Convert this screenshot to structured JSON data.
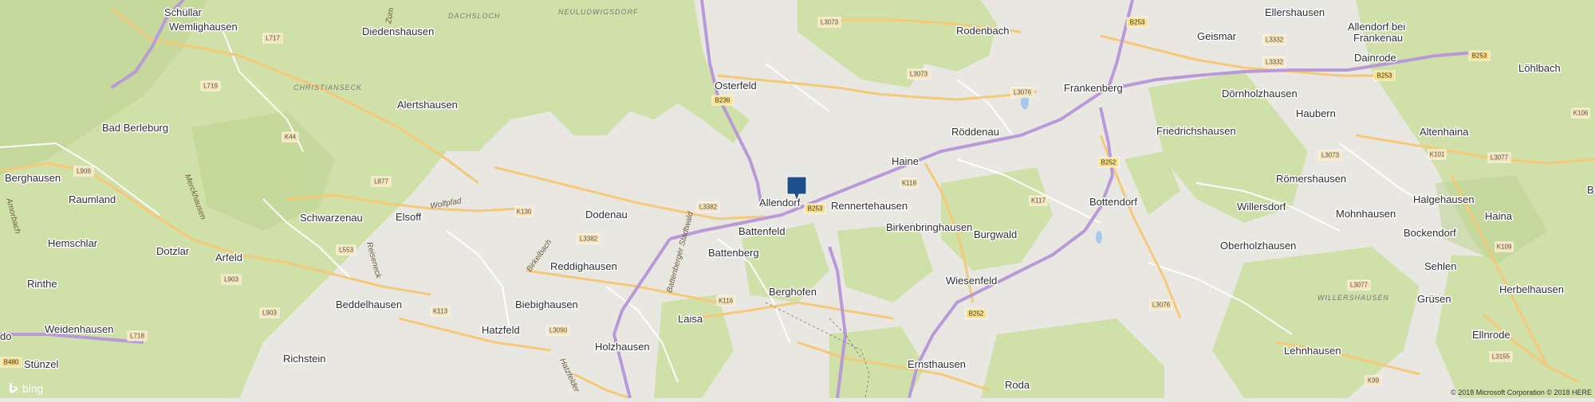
{
  "map": {
    "provider": "bing",
    "copyright": "© 2018 Microsoft Corporation © 2018 HERE",
    "colors": {
      "land": "#e9e7e2",
      "forest": "#cfe0a8",
      "forest_dark": "#bcd48f",
      "highway": "#b89ad8",
      "main_road": "#f5c97a",
      "minor_road": "#ffffff",
      "marker": "#1f4e8c",
      "water": "#a9c8ec"
    },
    "marker": {
      "icon": "map-pin-marker"
    },
    "places": [
      {
        "key": "schullar",
        "name": "Schüllar"
      },
      {
        "key": "wemlighausen",
        "name": "Wemlighausen"
      },
      {
        "key": "diedenshausen",
        "name": "Diedenshausen"
      },
      {
        "key": "alertshausen",
        "name": "Alertshausen"
      },
      {
        "key": "bad_berleburg",
        "name": "Bad Berleburg"
      },
      {
        "key": "berghausen",
        "name": "Berghausen"
      },
      {
        "key": "raumland",
        "name": "Raumland"
      },
      {
        "key": "schwarzenau",
        "name": "Schwarzenau"
      },
      {
        "key": "elsoff",
        "name": "Elsoff"
      },
      {
        "key": "hemschlar",
        "name": "Hemschlar"
      },
      {
        "key": "dotzlar",
        "name": "Dotzlar"
      },
      {
        "key": "arfeld",
        "name": "Arfeld"
      },
      {
        "key": "rinthe",
        "name": "Rinthe"
      },
      {
        "key": "beddelhausen",
        "name": "Beddelhausen"
      },
      {
        "key": "weidenhausen",
        "name": "Weidenhausen"
      },
      {
        "key": "stunzel",
        "name": "Stünzel"
      },
      {
        "key": "richstein",
        "name": "Richstein"
      },
      {
        "key": "hatzfeld",
        "name": "Hatzfeld"
      },
      {
        "key": "dodenau",
        "name": "Dodenau"
      },
      {
        "key": "reddighausen",
        "name": "Reddighausen"
      },
      {
        "key": "biebighausen",
        "name": "Biebighausen"
      },
      {
        "key": "holzhausen",
        "name": "Holzhausen"
      },
      {
        "key": "osterfeld",
        "name": "Osterfeld"
      },
      {
        "key": "allendorf",
        "name": "Allendorf"
      },
      {
        "key": "battenfeld",
        "name": "Battenfeld"
      },
      {
        "key": "battenberg",
        "name": "Battenberg"
      },
      {
        "key": "rennertehausen",
        "name": "Rennertehausen"
      },
      {
        "key": "haine",
        "name": "Haine"
      },
      {
        "key": "roddenau",
        "name": "Röddenau"
      },
      {
        "key": "rodenbach",
        "name": "Rodenbach"
      },
      {
        "key": "frankenberg",
        "name": "Frankenberg"
      },
      {
        "key": "birkenbringhausen",
        "name": "Birkenbringhausen"
      },
      {
        "key": "burgwald",
        "name": "Burgwald"
      },
      {
        "key": "wiesenfeld",
        "name": "Wiesenfeld"
      },
      {
        "key": "berghofen",
        "name": "Berghofen"
      },
      {
        "key": "laisa",
        "name": "Laisa"
      },
      {
        "key": "ernsthausen",
        "name": "Ernsthausen"
      },
      {
        "key": "roda",
        "name": "Roda"
      },
      {
        "key": "bottendorf",
        "name": "Bottendorf"
      },
      {
        "key": "geismar",
        "name": "Geismar"
      },
      {
        "key": "ellershausen",
        "name": "Ellershausen"
      },
      {
        "key": "allendorf_bei_frankenau_1",
        "name": "Allendorf bei"
      },
      {
        "key": "allendorf_bei_frankenau_2",
        "name": "Frankenau"
      },
      {
        "key": "dainrode",
        "name": "Dainrode"
      },
      {
        "key": "lohlbach",
        "name": "Löhlbach"
      },
      {
        "key": "dornholzhausen",
        "name": "Dörnholzhausen"
      },
      {
        "key": "friedrichshausen",
        "name": "Friedrichshausen"
      },
      {
        "key": "haubern",
        "name": "Haubern"
      },
      {
        "key": "altenhaina",
        "name": "Altenhaina"
      },
      {
        "key": "romershausen",
        "name": "Römershausen"
      },
      {
        "key": "willersdorf",
        "name": "Willersdorf"
      },
      {
        "key": "mohnhausen",
        "name": "Mohnhausen"
      },
      {
        "key": "halgehausen",
        "name": "Halgehausen"
      },
      {
        "key": "haina",
        "name": "Haina"
      },
      {
        "key": "bockendorf",
        "name": "Bockendorf"
      },
      {
        "key": "oberholzhausen",
        "name": "Oberholzhausen"
      },
      {
        "key": "sehlen",
        "name": "Sehlen"
      },
      {
        "key": "grusen",
        "name": "Grüsen"
      },
      {
        "key": "herbelhausen",
        "name": "Herbelhausen"
      },
      {
        "key": "ellnrode",
        "name": "Ellnrode"
      },
      {
        "key": "lehnhausen",
        "name": "Lehnhausen"
      },
      {
        "key": "edge_b",
        "name": "B"
      },
      {
        "key": "edge_do",
        "name": "do"
      }
    ],
    "areas": [
      {
        "key": "dachsloch",
        "name": "DACHSLOCH"
      },
      {
        "key": "neuludwigsdorf",
        "name": "NEULUDWIGSDORF"
      },
      {
        "key": "christianseck",
        "name": "CHRISTIANSECK"
      },
      {
        "key": "willershausen",
        "name": "WILLERSHAUSEN"
      }
    ],
    "streets": [
      {
        "key": "wolfpfad",
        "name": "Wolfpfad"
      },
      {
        "key": "battenberger_stadtwald",
        "name": "Battenberger Stadtwald"
      },
      {
        "key": "birkelbach",
        "name": "Birkelbach"
      },
      {
        "key": "merckhausen",
        "name": "Merckhausen"
      },
      {
        "key": "zum",
        "name": "Zum"
      },
      {
        "key": "hatzfelder",
        "name": "Hatzfelder"
      },
      {
        "key": "amorbach",
        "name": "Amorbach"
      },
      {
        "key": "reiseneck",
        "name": "Reiseneck"
      }
    ],
    "road_labels": [
      {
        "key": "L3073_a",
        "label": "L3073",
        "kind": "L"
      },
      {
        "key": "L3073_b",
        "label": "L3073",
        "kind": "L"
      },
      {
        "key": "B253_ne",
        "label": "B253",
        "kind": "B"
      },
      {
        "key": "L3332_a",
        "label": "L3332",
        "kind": "L"
      },
      {
        "key": "L3332_b",
        "label": "L3332",
        "kind": "L"
      },
      {
        "key": "B253_e",
        "label": "B253",
        "kind": "B"
      },
      {
        "key": "B253_x",
        "label": "B253",
        "kind": "B"
      },
      {
        "key": "L717",
        "label": "L717",
        "kind": "L"
      },
      {
        "key": "L719",
        "label": "L719",
        "kind": "L"
      },
      {
        "key": "B236",
        "label": "B236",
        "kind": "B"
      },
      {
        "key": "L3076_a",
        "label": "L3076",
        "kind": "L"
      },
      {
        "key": "K44",
        "label": "K44",
        "kind": "L"
      },
      {
        "key": "B252_a",
        "label": "B252",
        "kind": "B"
      },
      {
        "key": "L3073_c",
        "label": "L3073",
        "kind": "L"
      },
      {
        "key": "K101",
        "label": "K101",
        "kind": "L"
      },
      {
        "key": "L3077_a",
        "label": "L3077",
        "kind": "L"
      },
      {
        "key": "K106",
        "label": "K106",
        "kind": "L"
      },
      {
        "key": "L906",
        "label": "L906",
        "kind": "L"
      },
      {
        "key": "L877",
        "label": "L877",
        "kind": "L"
      },
      {
        "key": "K118",
        "label": "K118",
        "kind": "L"
      },
      {
        "key": "K130",
        "label": "K130",
        "kind": "L"
      },
      {
        "key": "L3382_a",
        "label": "L3382",
        "kind": "L"
      },
      {
        "key": "B253_m",
        "label": "B253",
        "kind": "B"
      },
      {
        "key": "K117",
        "label": "K117",
        "kind": "L"
      },
      {
        "key": "L3382_b",
        "label": "L3382",
        "kind": "L"
      },
      {
        "key": "L553",
        "label": "L553",
        "kind": "L"
      },
      {
        "key": "L903_a",
        "label": "L903",
        "kind": "L"
      },
      {
        "key": "K109",
        "label": "K109",
        "kind": "L"
      },
      {
        "key": "L903_b",
        "label": "L903",
        "kind": "L"
      },
      {
        "key": "K116",
        "label": "K116",
        "kind": "L"
      },
      {
        "key": "L3076_b",
        "label": "L3076",
        "kind": "L"
      },
      {
        "key": "L3077_b",
        "label": "L3077",
        "kind": "L"
      },
      {
        "key": "K113",
        "label": "K113",
        "kind": "L"
      },
      {
        "key": "B252_b",
        "label": "B252",
        "kind": "B"
      },
      {
        "key": "L718",
        "label": "L718",
        "kind": "L"
      },
      {
        "key": "L3090",
        "label": "L3090",
        "kind": "L"
      },
      {
        "key": "B480",
        "label": "B480",
        "kind": "B"
      },
      {
        "key": "L3155",
        "label": "L3155",
        "kind": "L"
      },
      {
        "key": "K99",
        "label": "K99",
        "kind": "L"
      }
    ]
  }
}
